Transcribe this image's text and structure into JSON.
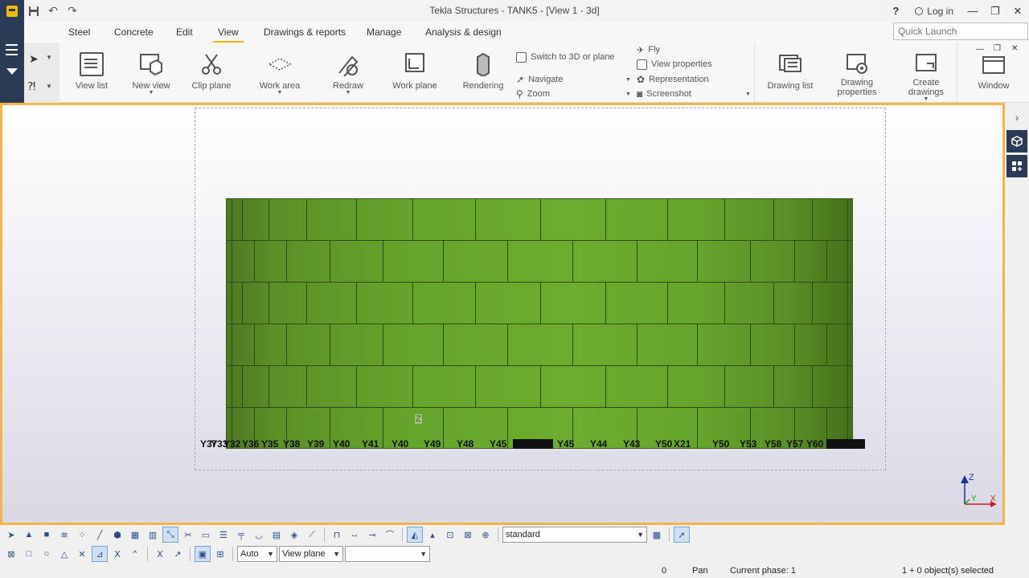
{
  "titlebar": {
    "title": "Tekla Structures - TANK5  - [View 1 - 3d]",
    "help_label": "?",
    "login_label": "Log in"
  },
  "ribbon_tabs": [
    "Steel",
    "Concrete",
    "Edit",
    "View",
    "Drawings & reports",
    "Manage",
    "Analysis & design"
  ],
  "active_tab": "View",
  "quick_launch": {
    "placeholder": "Quick Launch"
  },
  "ribbon": {
    "view_list": "View list",
    "new_view": "New view",
    "clip_plane": "Clip plane",
    "work_area": "Work area",
    "redraw": "Redraw",
    "work_plane": "Work plane",
    "rendering": "Rendering",
    "switch_3d": "Switch to 3D or plane",
    "navigate": "Navigate",
    "zoom": "Zoom",
    "fly": "Fly",
    "view_properties": "View properties",
    "representation": "Representation",
    "screenshot": "Screenshot",
    "drawing_list": "Drawing list",
    "drawing_properties_1": "Drawing",
    "drawing_properties_2": "properties",
    "create_drawings_1": "Create",
    "create_drawings_2": "drawings",
    "window": "Window"
  },
  "model": {
    "z_marker": "Z",
    "grid_labels": [
      "Y37",
      "Y33",
      "Y32",
      "Y36",
      "Y35",
      "Y38",
      "Y39",
      "Y40",
      "Y41",
      "Y40",
      "Y49",
      "Y48",
      "Y45",
      "Y45",
      "Y44",
      "Y43",
      "Y50",
      "X21",
      "Y50",
      "Y53",
      "Y58",
      "Y57",
      "Y60"
    ],
    "axis_labels": {
      "z": "Z",
      "y": "Y",
      "x": "X"
    },
    "colors": {
      "tank": "#66a52c",
      "frame": "#f5b44a"
    }
  },
  "bottom_toolbar": {
    "filter_value": "standard",
    "snap_mode": "Auto",
    "plane_mode": "View plane",
    "extra_value": ""
  },
  "statusbar": {
    "count": "0",
    "mode": "Pan",
    "phase": "Current phase: 1",
    "selection": "1 + 0 object(s) selected"
  }
}
